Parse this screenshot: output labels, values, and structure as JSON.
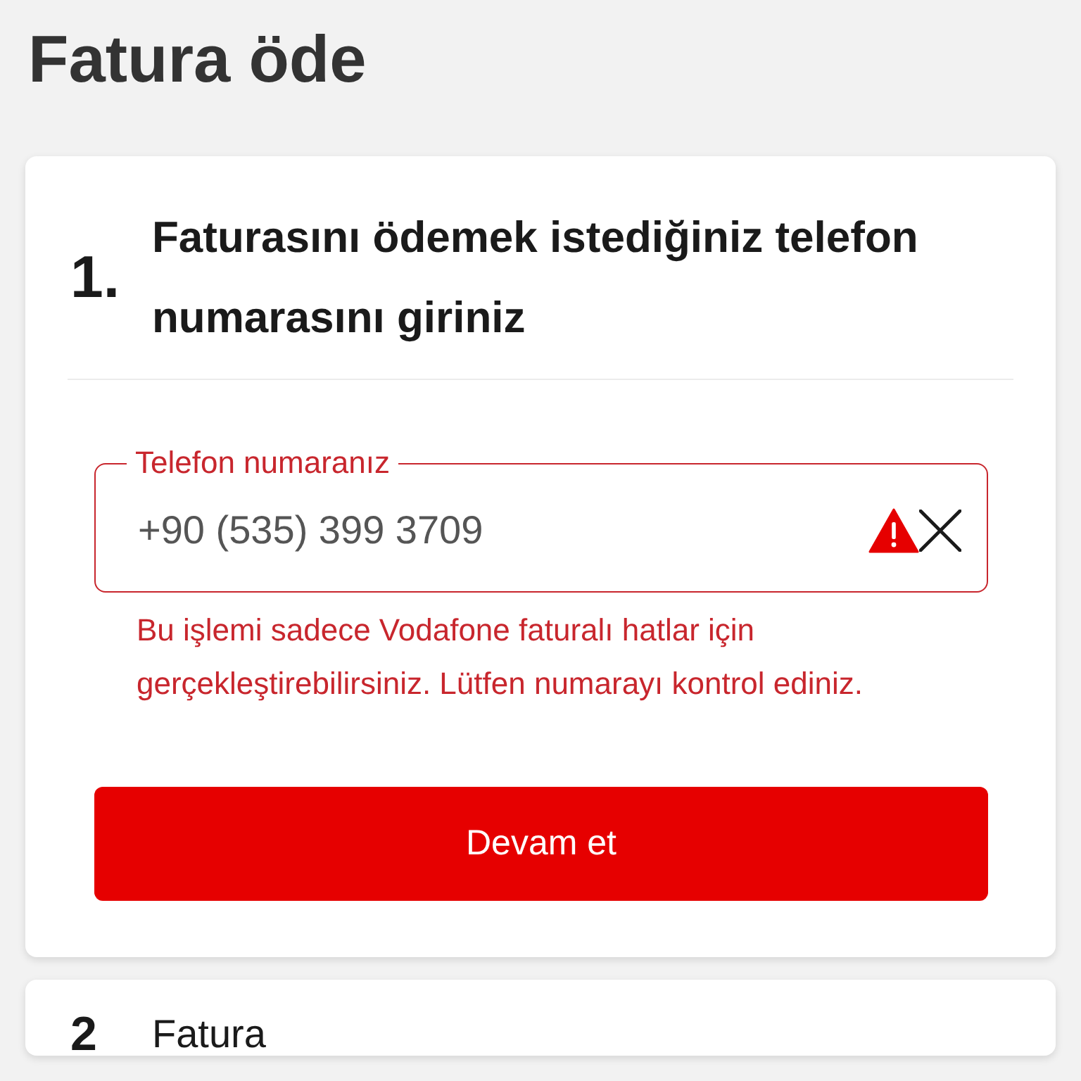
{
  "page": {
    "title": "Fatura öde"
  },
  "steps": [
    {
      "number": "1.",
      "title": "Faturasını ödemek istediğiniz telefon numarasını giriniz",
      "active": true,
      "phone_field": {
        "label": "Telefon numaranız",
        "value": "+90 (535) 399 3709",
        "invalid": true,
        "error_message": "Bu işlemi sadece Vodafone faturalı hatlar için gerçekleştirebilirsiniz. Lütfen numarayı kontrol ediniz."
      },
      "button": "Devam et"
    },
    {
      "number": "2",
      "title": "Fatura",
      "active": false
    }
  ]
}
